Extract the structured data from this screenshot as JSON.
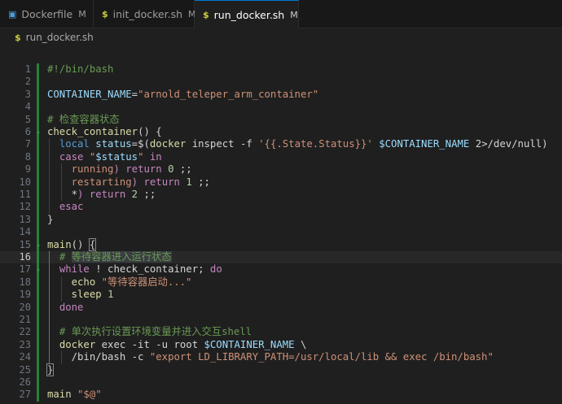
{
  "tabs": [
    {
      "name": "Dockerfile",
      "status": "M",
      "icon": "docker-icon",
      "color": "#4a9fe0",
      "active": false
    },
    {
      "name": "init_docker.sh",
      "status": "M",
      "icon": "shell-icon",
      "color": "#cbcb41",
      "active": false
    },
    {
      "name": "run_docker.sh",
      "status": "M",
      "icon": "shell-icon",
      "color": "#cbcb41",
      "active": true,
      "unsaved": true
    }
  ],
  "breadcrumb": {
    "file": "run_docker.sh",
    "icon": "shell-icon"
  },
  "editor": {
    "current_line": 16,
    "lines": [
      {
        "n": "1",
        "tokens": [
          [
            "c-comment",
            "#!/bin/bash"
          ]
        ]
      },
      {
        "n": "2",
        "tokens": []
      },
      {
        "n": "3",
        "tokens": [
          [
            "c-var",
            "CONTAINER_NAME"
          ],
          [
            "c-op",
            "="
          ],
          [
            "c-str",
            "\"arnold_teleper_arm_container\""
          ]
        ]
      },
      {
        "n": "4",
        "tokens": []
      },
      {
        "n": "5",
        "tokens": [
          [
            "c-comment",
            "# 检查容器状态"
          ]
        ]
      },
      {
        "n": "6",
        "fold": true,
        "tokens": [
          [
            "c-fn",
            "check_container"
          ],
          [
            "c-plain",
            "() {"
          ]
        ]
      },
      {
        "n": "7",
        "tokens": [
          [
            "c-plain",
            "  "
          ],
          [
            "c-kw2",
            "local"
          ],
          [
            "c-plain",
            " "
          ],
          [
            "c-var",
            "status"
          ],
          [
            "c-op",
            "="
          ],
          [
            "c-plain",
            "$("
          ],
          [
            "c-fn",
            "docker"
          ],
          [
            "c-plain",
            " inspect -f "
          ],
          [
            "c-str",
            "'{{.State.Status}}'"
          ],
          [
            "c-plain",
            " "
          ],
          [
            "c-var",
            "$CONTAINER_NAME"
          ],
          [
            "c-plain",
            " 2>/dev/null)"
          ]
        ]
      },
      {
        "n": "8",
        "tokens": [
          [
            "c-plain",
            "  "
          ],
          [
            "c-kw",
            "case"
          ],
          [
            "c-plain",
            " "
          ],
          [
            "c-str",
            "\""
          ],
          [
            "c-var",
            "$status"
          ],
          [
            "c-str",
            "\""
          ],
          [
            "c-plain",
            " "
          ],
          [
            "c-kw",
            "in"
          ]
        ]
      },
      {
        "n": "9",
        "tokens": [
          [
            "c-plain",
            "    "
          ],
          [
            "c-str",
            "running"
          ],
          [
            "c-kw",
            ")"
          ],
          [
            "c-plain",
            " "
          ],
          [
            "c-kw",
            "return"
          ],
          [
            "c-plain",
            " "
          ],
          [
            "c-num",
            "0"
          ],
          [
            "c-plain",
            " ;;"
          ]
        ]
      },
      {
        "n": "10",
        "tokens": [
          [
            "c-plain",
            "    "
          ],
          [
            "c-str",
            "restarting"
          ],
          [
            "c-kw",
            ")"
          ],
          [
            "c-plain",
            " "
          ],
          [
            "c-kw",
            "return"
          ],
          [
            "c-plain",
            " "
          ],
          [
            "c-num",
            "1"
          ],
          [
            "c-plain",
            " ;;"
          ]
        ]
      },
      {
        "n": "11",
        "tokens": [
          [
            "c-plain",
            "    *"
          ],
          [
            "c-kw",
            ")"
          ],
          [
            "c-plain",
            " "
          ],
          [
            "c-kw",
            "return"
          ],
          [
            "c-plain",
            " "
          ],
          [
            "c-num",
            "2"
          ],
          [
            "c-plain",
            " ;;"
          ]
        ]
      },
      {
        "n": "12",
        "tokens": [
          [
            "c-plain",
            "  "
          ],
          [
            "c-kw",
            "esac"
          ]
        ]
      },
      {
        "n": "13",
        "tokens": [
          [
            "c-plain",
            "}"
          ]
        ]
      },
      {
        "n": "14",
        "tokens": []
      },
      {
        "n": "15",
        "fold": true,
        "tokens": [
          [
            "c-fn",
            "main"
          ],
          [
            "c-plain",
            "() "
          ],
          [
            "c-brace-hl",
            "{"
          ]
        ]
      },
      {
        "n": "16",
        "tokens": [
          [
            "c-plain",
            "  "
          ],
          [
            "c-comment",
            "# "
          ],
          [
            "c-comment c-sel",
            "等待容器进入运行状态"
          ]
        ]
      },
      {
        "n": "17",
        "fold": true,
        "tokens": [
          [
            "c-plain",
            "  "
          ],
          [
            "c-kw",
            "while"
          ],
          [
            "c-plain",
            " ! check_container; "
          ],
          [
            "c-kw",
            "do"
          ]
        ]
      },
      {
        "n": "18",
        "tokens": [
          [
            "c-plain",
            "    "
          ],
          [
            "c-fn",
            "echo"
          ],
          [
            "c-plain",
            " "
          ],
          [
            "c-str",
            "\"等待容器启动...\""
          ]
        ]
      },
      {
        "n": "19",
        "tokens": [
          [
            "c-plain",
            "    "
          ],
          [
            "c-fn",
            "sleep"
          ],
          [
            "c-plain",
            " "
          ],
          [
            "c-num",
            "1"
          ]
        ]
      },
      {
        "n": "20",
        "tokens": [
          [
            "c-plain",
            "  "
          ],
          [
            "c-kw",
            "done"
          ]
        ]
      },
      {
        "n": "21",
        "tokens": []
      },
      {
        "n": "22",
        "tokens": [
          [
            "c-plain",
            "  "
          ],
          [
            "c-comment",
            "# 单次执行设置环境变量并进入交互shell"
          ]
        ]
      },
      {
        "n": "23",
        "tokens": [
          [
            "c-plain",
            "  "
          ],
          [
            "c-fn",
            "docker"
          ],
          [
            "c-plain",
            " exec -it -u root "
          ],
          [
            "c-var",
            "$CONTAINER_NAME"
          ],
          [
            "c-plain",
            " \\"
          ]
        ]
      },
      {
        "n": "24",
        "tokens": [
          [
            "c-plain",
            "    /bin/bash -c "
          ],
          [
            "c-str",
            "\"export LD_LIBRARY_PATH=/usr/local/lib && exec /bin/bash\""
          ]
        ]
      },
      {
        "n": "25",
        "tokens": [
          [
            "c-brace-hl",
            "}"
          ]
        ]
      },
      {
        "n": "26",
        "tokens": []
      },
      {
        "n": "27",
        "tokens": [
          [
            "c-fn",
            "main"
          ],
          [
            "c-plain",
            " "
          ],
          [
            "c-str",
            "\"$@\""
          ]
        ]
      }
    ]
  }
}
